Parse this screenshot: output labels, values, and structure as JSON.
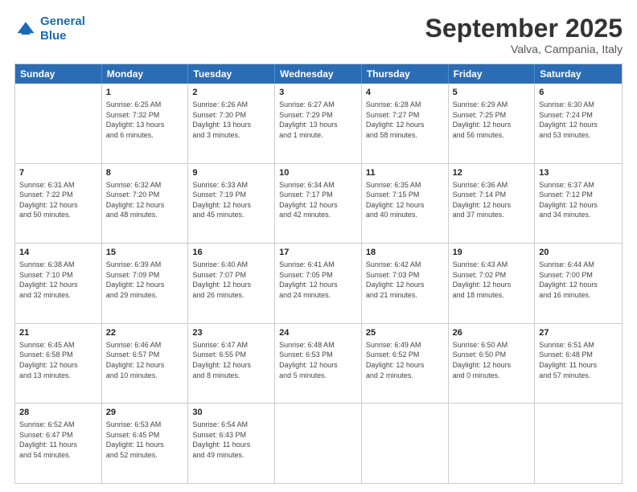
{
  "logo": {
    "line1": "General",
    "line2": "Blue"
  },
  "header": {
    "month": "September 2025",
    "location": "Valva, Campania, Italy"
  },
  "days": [
    "Sunday",
    "Monday",
    "Tuesday",
    "Wednesday",
    "Thursday",
    "Friday",
    "Saturday"
  ],
  "rows": [
    [
      {
        "num": "",
        "info": ""
      },
      {
        "num": "1",
        "info": "Sunrise: 6:25 AM\nSunset: 7:32 PM\nDaylight: 13 hours\nand 6 minutes."
      },
      {
        "num": "2",
        "info": "Sunrise: 6:26 AM\nSunset: 7:30 PM\nDaylight: 13 hours\nand 3 minutes."
      },
      {
        "num": "3",
        "info": "Sunrise: 6:27 AM\nSunset: 7:29 PM\nDaylight: 13 hours\nand 1 minute."
      },
      {
        "num": "4",
        "info": "Sunrise: 6:28 AM\nSunset: 7:27 PM\nDaylight: 12 hours\nand 58 minutes."
      },
      {
        "num": "5",
        "info": "Sunrise: 6:29 AM\nSunset: 7:25 PM\nDaylight: 12 hours\nand 56 minutes."
      },
      {
        "num": "6",
        "info": "Sunrise: 6:30 AM\nSunset: 7:24 PM\nDaylight: 12 hours\nand 53 minutes."
      }
    ],
    [
      {
        "num": "7",
        "info": "Sunrise: 6:31 AM\nSunset: 7:22 PM\nDaylight: 12 hours\nand 50 minutes."
      },
      {
        "num": "8",
        "info": "Sunrise: 6:32 AM\nSunset: 7:20 PM\nDaylight: 12 hours\nand 48 minutes."
      },
      {
        "num": "9",
        "info": "Sunrise: 6:33 AM\nSunset: 7:19 PM\nDaylight: 12 hours\nand 45 minutes."
      },
      {
        "num": "10",
        "info": "Sunrise: 6:34 AM\nSunset: 7:17 PM\nDaylight: 12 hours\nand 42 minutes."
      },
      {
        "num": "11",
        "info": "Sunrise: 6:35 AM\nSunset: 7:15 PM\nDaylight: 12 hours\nand 40 minutes."
      },
      {
        "num": "12",
        "info": "Sunrise: 6:36 AM\nSunset: 7:14 PM\nDaylight: 12 hours\nand 37 minutes."
      },
      {
        "num": "13",
        "info": "Sunrise: 6:37 AM\nSunset: 7:12 PM\nDaylight: 12 hours\nand 34 minutes."
      }
    ],
    [
      {
        "num": "14",
        "info": "Sunrise: 6:38 AM\nSunset: 7:10 PM\nDaylight: 12 hours\nand 32 minutes."
      },
      {
        "num": "15",
        "info": "Sunrise: 6:39 AM\nSunset: 7:09 PM\nDaylight: 12 hours\nand 29 minutes."
      },
      {
        "num": "16",
        "info": "Sunrise: 6:40 AM\nSunset: 7:07 PM\nDaylight: 12 hours\nand 26 minutes."
      },
      {
        "num": "17",
        "info": "Sunrise: 6:41 AM\nSunset: 7:05 PM\nDaylight: 12 hours\nand 24 minutes."
      },
      {
        "num": "18",
        "info": "Sunrise: 6:42 AM\nSunset: 7:03 PM\nDaylight: 12 hours\nand 21 minutes."
      },
      {
        "num": "19",
        "info": "Sunrise: 6:43 AM\nSunset: 7:02 PM\nDaylight: 12 hours\nand 18 minutes."
      },
      {
        "num": "20",
        "info": "Sunrise: 6:44 AM\nSunset: 7:00 PM\nDaylight: 12 hours\nand 16 minutes."
      }
    ],
    [
      {
        "num": "21",
        "info": "Sunrise: 6:45 AM\nSunset: 6:58 PM\nDaylight: 12 hours\nand 13 minutes."
      },
      {
        "num": "22",
        "info": "Sunrise: 6:46 AM\nSunset: 6:57 PM\nDaylight: 12 hours\nand 10 minutes."
      },
      {
        "num": "23",
        "info": "Sunrise: 6:47 AM\nSunset: 6:55 PM\nDaylight: 12 hours\nand 8 minutes."
      },
      {
        "num": "24",
        "info": "Sunrise: 6:48 AM\nSunset: 6:53 PM\nDaylight: 12 hours\nand 5 minutes."
      },
      {
        "num": "25",
        "info": "Sunrise: 6:49 AM\nSunset: 6:52 PM\nDaylight: 12 hours\nand 2 minutes."
      },
      {
        "num": "26",
        "info": "Sunrise: 6:50 AM\nSunset: 6:50 PM\nDaylight: 12 hours\nand 0 minutes."
      },
      {
        "num": "27",
        "info": "Sunrise: 6:51 AM\nSunset: 6:48 PM\nDaylight: 11 hours\nand 57 minutes."
      }
    ],
    [
      {
        "num": "28",
        "info": "Sunrise: 6:52 AM\nSunset: 6:47 PM\nDaylight: 11 hours\nand 54 minutes."
      },
      {
        "num": "29",
        "info": "Sunrise: 6:53 AM\nSunset: 6:45 PM\nDaylight: 11 hours\nand 52 minutes."
      },
      {
        "num": "30",
        "info": "Sunrise: 6:54 AM\nSunset: 6:43 PM\nDaylight: 11 hours\nand 49 minutes."
      },
      {
        "num": "",
        "info": ""
      },
      {
        "num": "",
        "info": ""
      },
      {
        "num": "",
        "info": ""
      },
      {
        "num": "",
        "info": ""
      }
    ]
  ]
}
